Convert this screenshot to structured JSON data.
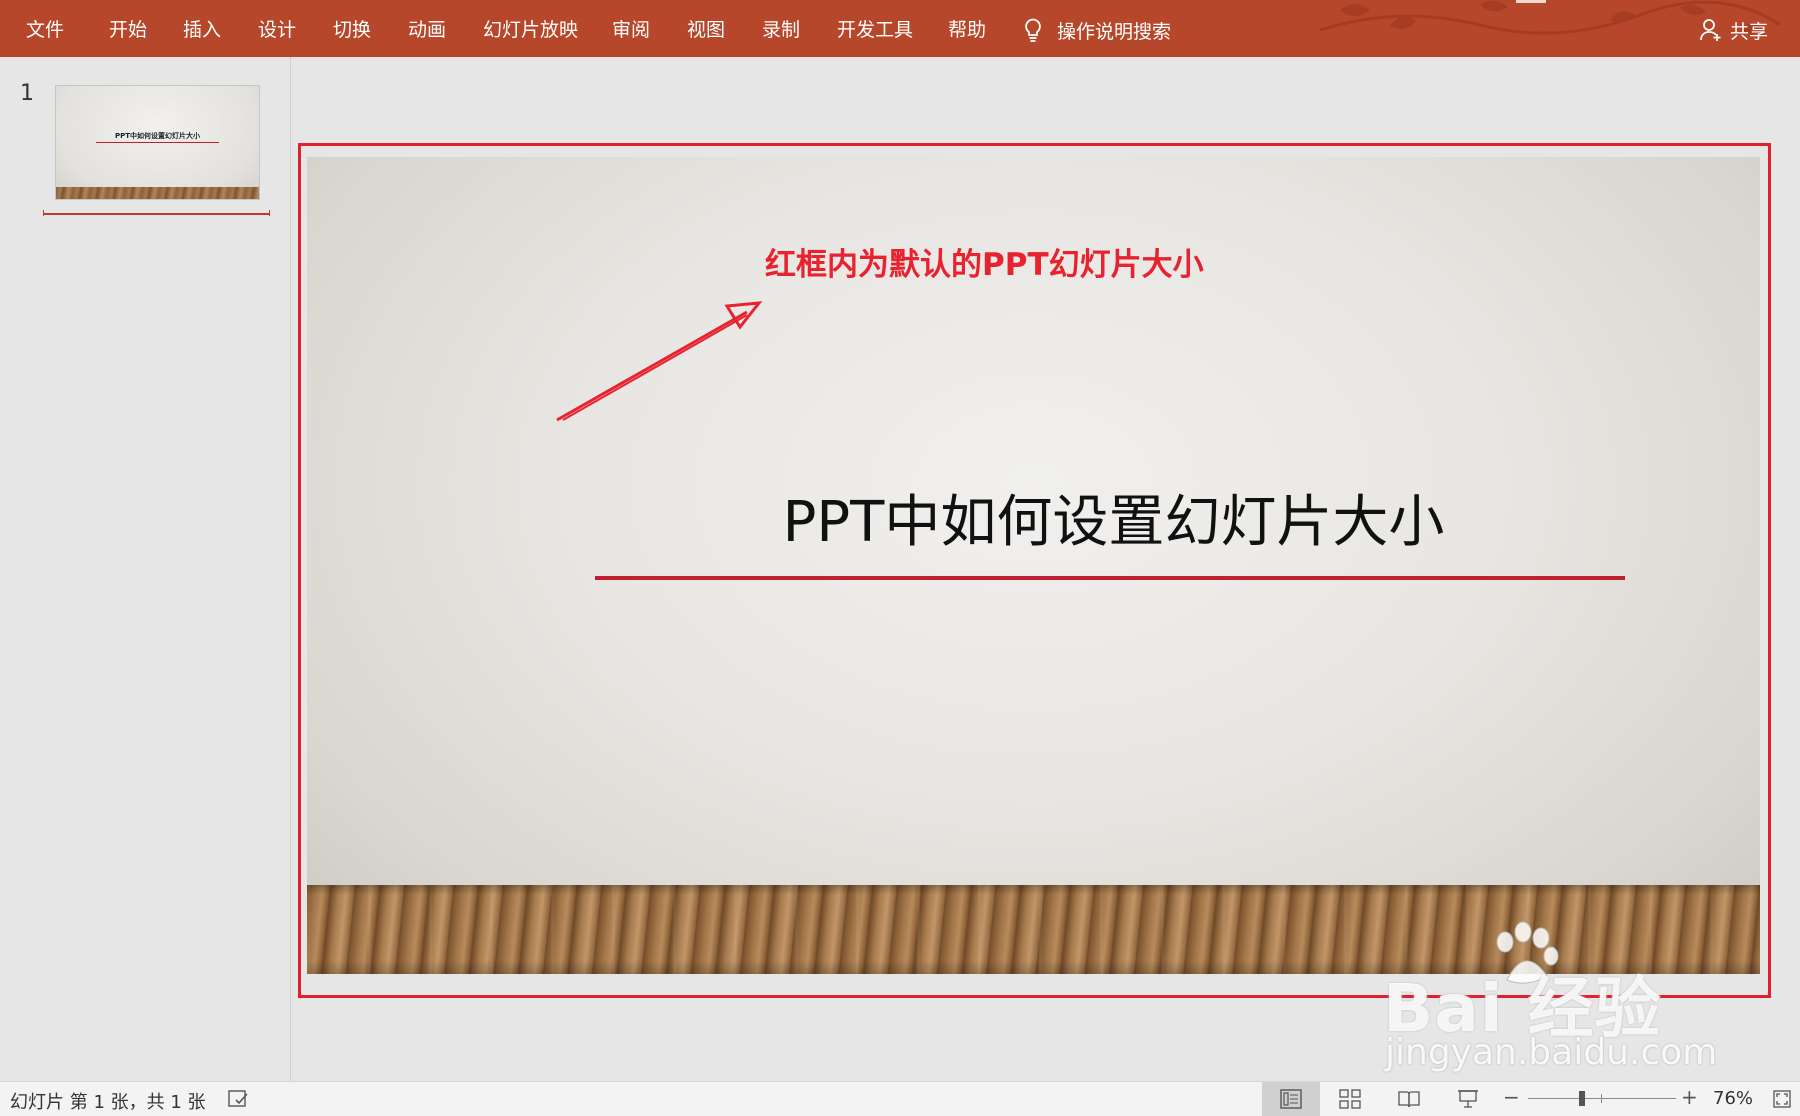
{
  "ribbon": {
    "tabs": [
      "文件",
      "开始",
      "插入",
      "设计",
      "切换",
      "动画",
      "幻灯片放映",
      "审阅",
      "视图",
      "录制",
      "开发工具",
      "帮助"
    ],
    "tell_me": "操作说明搜索",
    "share": "共享",
    "color": "#b7472a"
  },
  "thumbnails": {
    "number": "1",
    "title": "PPT中如何设置幻灯片大小"
  },
  "slide": {
    "annotation": "红框内为默认的PPT幻灯片大小",
    "title": "PPT中如何设置幻灯片大小",
    "accent_color": "#c0202f",
    "annotation_color": "#e8232f"
  },
  "watermark": {
    "brand": "Bai 经验",
    "url": "jingyan.baidu.com"
  },
  "statusbar": {
    "slide_info": "幻灯片 第 1 张，共 1 张",
    "zoom": "76%",
    "zoom_minus": "−",
    "zoom_plus": "+"
  }
}
